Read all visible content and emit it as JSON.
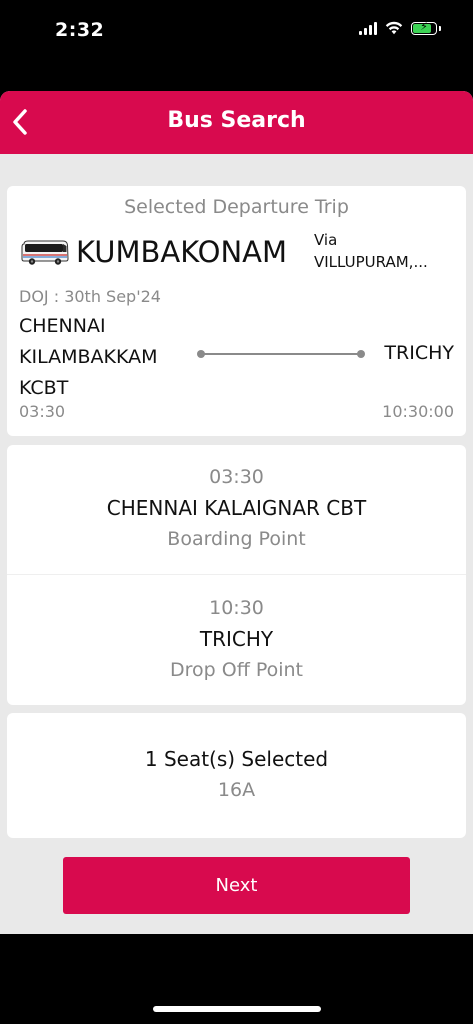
{
  "status_bar": {
    "time": "2:32"
  },
  "header": {
    "title": "Bus Search",
    "back_icon": "chevron-left-icon"
  },
  "trip": {
    "heading": "Selected Departure Trip",
    "bus_icon": "bus-icon",
    "destination": "KUMBAKONAM",
    "via_label": "Via",
    "via_route": "VILLUPURAM,...",
    "doj": "DOJ : 30th Sep'24",
    "origin": "CHENNAI KILAMBAKKAM KCBT",
    "destination_stop": "TRICHY",
    "departure_time": "03:30",
    "arrival_time": "10:30:00"
  },
  "boarding": {
    "time": "03:30",
    "name": "CHENNAI KALAIGNAR CBT",
    "label": "Boarding Point"
  },
  "dropoff": {
    "time": "10:30",
    "name": "TRICHY",
    "label": "Drop Off Point"
  },
  "seats": {
    "count_text": "1 Seat(s) Selected",
    "seat_numbers": "16A"
  },
  "actions": {
    "next_label": "Next"
  },
  "colors": {
    "brand": "#d80a4e",
    "background": "#e9e9e9",
    "muted_text": "#8a8a8a"
  }
}
